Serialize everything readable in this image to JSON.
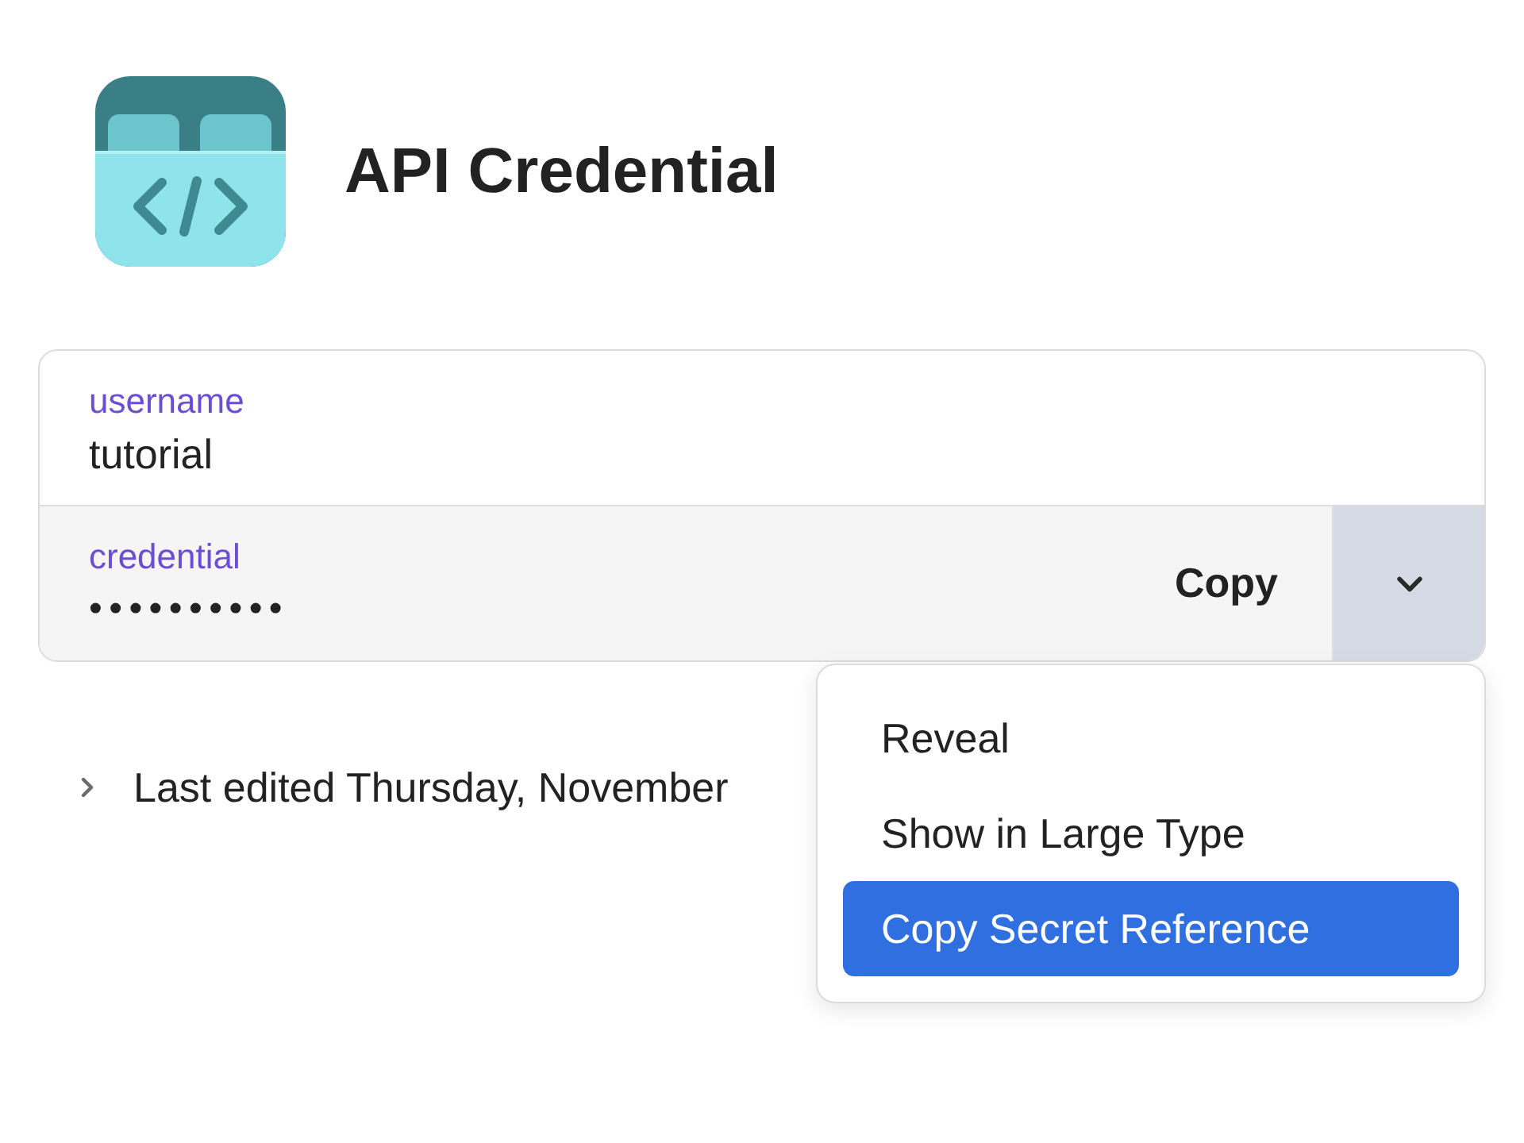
{
  "item": {
    "title": "API Credential"
  },
  "fields": [
    {
      "kind": "text",
      "label": "username",
      "value": "tutorial"
    },
    {
      "kind": "concealed",
      "label": "credential",
      "value": "••••••••••",
      "action": "Copy",
      "menu_expanded": true
    }
  ],
  "menu": {
    "items": [
      {
        "label": "Reveal",
        "selected": false
      },
      {
        "label": "Show in Large Type",
        "selected": false
      },
      {
        "label": "Copy Secret Reference",
        "selected": true
      }
    ]
  },
  "history": {
    "text": "Last edited Thursday, November",
    "expanded": false
  }
}
